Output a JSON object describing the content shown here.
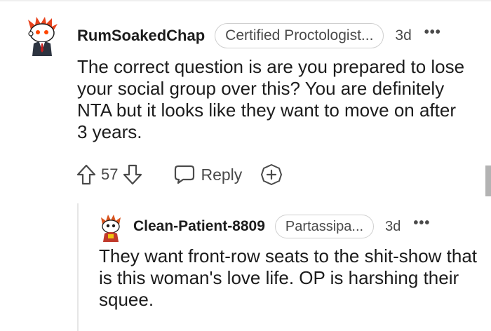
{
  "comments": [
    {
      "username": "RumSoakedChap",
      "flair": "Certified Proctologist...",
      "time": "3d",
      "more": "•••",
      "body": "The correct question is are you prepared to lose your social group over this? You are definitely NTA but it looks like they want to move on after 3 years.",
      "votes": "57",
      "reply_label": "Reply"
    },
    {
      "username": "Clean-Patient-8809",
      "flair": "Partassipa...",
      "time": "3d",
      "more": "•••",
      "body": "They want front-row seats to the shit-show that is this woman's love life. OP is harshing their squee."
    }
  ],
  "icons": {
    "upvote": "upvote-arrow-icon",
    "downvote": "downvote-arrow-icon",
    "reply": "speech-bubble-icon",
    "award": "plus-award-icon",
    "more": "more-options-icon"
  },
  "colors": {
    "text": "#1c1c1c",
    "muted": "#4a4a4a",
    "flair_border": "#cfcfcf",
    "avatar_orange": "#ff4500"
  }
}
